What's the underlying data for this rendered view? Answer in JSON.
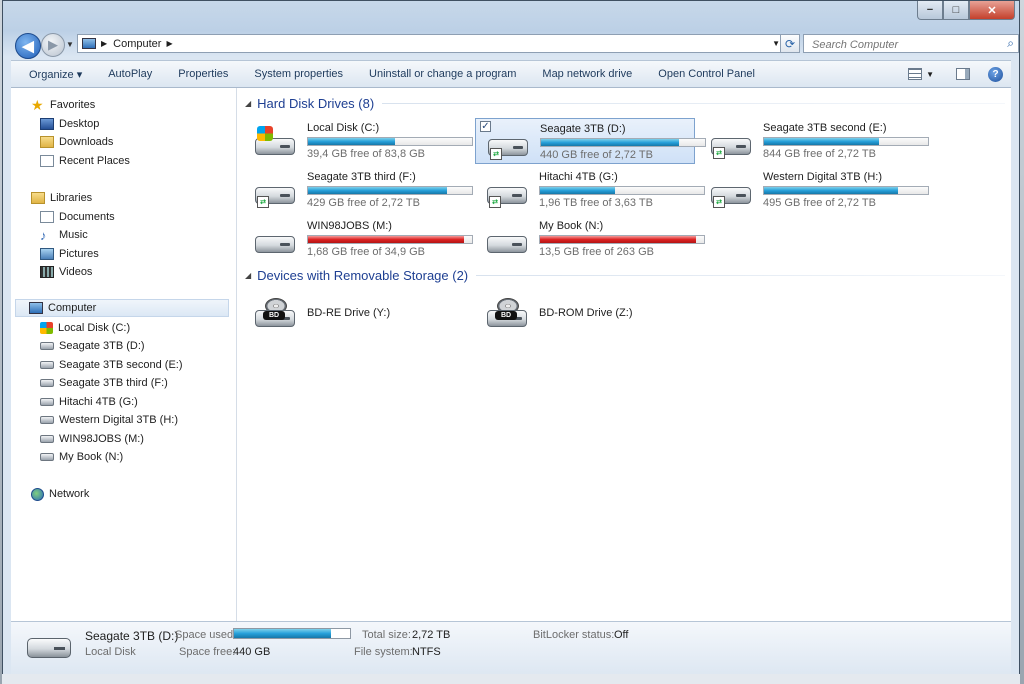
{
  "window": {
    "minimize": "−",
    "maximize": "□",
    "close": "✕"
  },
  "address": {
    "crumb": "Computer",
    "search_placeholder": "Search Computer"
  },
  "toolbar": {
    "organize": "Organize ▾",
    "autoplay": "AutoPlay",
    "properties": "Properties",
    "system_properties": "System properties",
    "uninstall": "Uninstall or change a program",
    "map_drive": "Map network drive",
    "control_panel": "Open Control Panel"
  },
  "nav": {
    "favorites": "Favorites",
    "desktop": "Desktop",
    "downloads": "Downloads",
    "recent": "Recent Places",
    "libraries": "Libraries",
    "documents": "Documents",
    "music": "Music",
    "pictures": "Pictures",
    "videos": "Videos",
    "computer": "Computer",
    "drives": [
      "Local Disk (C:)",
      "Seagate 3TB (D:)",
      "Seagate 3TB second (E:)",
      "Seagate 3TB third (F:)",
      "Hitachi 4TB (G:)",
      "Western Digital 3TB (H:)",
      "WIN98JOBS (M:)",
      "My Book (N:)"
    ],
    "network": "Network"
  },
  "groups": {
    "hdd": "Hard Disk Drives (8)",
    "removable": "Devices with Removable Storage (2)"
  },
  "drives": [
    {
      "name": "Local Disk (C:)",
      "free": "39,4 GB free of 83,8 GB",
      "used_fraction": 0.53,
      "status": "normal"
    },
    {
      "name": "Seagate 3TB (D:)",
      "free": "440 GB free of 2,72 TB",
      "used_fraction": 0.84,
      "status": "normal"
    },
    {
      "name": "Seagate 3TB second (E:)",
      "free": "844 GB free of 2,72 TB",
      "used_fraction": 0.7,
      "status": "normal"
    },
    {
      "name": "Seagate 3TB third (F:)",
      "free": "429 GB free of 2,72 TB",
      "used_fraction": 0.85,
      "status": "normal"
    },
    {
      "name": "Hitachi 4TB (G:)",
      "free": "1,96 TB free of 3,63 TB",
      "used_fraction": 0.46,
      "status": "normal"
    },
    {
      "name": "Western Digital 3TB (H:)",
      "free": "495 GB free of 2,72 TB",
      "used_fraction": 0.82,
      "status": "normal"
    },
    {
      "name": "WIN98JOBS (M:)",
      "free": "1,68 GB free of 34,9 GB",
      "used_fraction": 0.95,
      "status": "full"
    },
    {
      "name": "My Book (N:)",
      "free": "13,5 GB free of 263 GB",
      "used_fraction": 0.95,
      "status": "full"
    }
  ],
  "removable": [
    {
      "name": "BD-RE Drive (Y:)",
      "badge": "BD"
    },
    {
      "name": "BD-ROM Drive (Z:)",
      "badge": "BD"
    }
  ],
  "details": {
    "title": "Seagate 3TB (D:)",
    "subtitle": "Local Disk",
    "space_used_label": "Space used:",
    "space_used_fraction": 0.84,
    "space_free_label": "Space free:",
    "space_free": "440 GB",
    "total_size_label": "Total size:",
    "total_size": "2,72 TB",
    "fs_label": "File system:",
    "fs": "NTFS",
    "bitlocker_label": "BitLocker status:",
    "bitlocker": "Off"
  },
  "colors": {
    "accent": "#1e3f92",
    "bar_normal": "#26a0da",
    "bar_full": "#dd2222",
    "selection": "#cfe1f7"
  }
}
